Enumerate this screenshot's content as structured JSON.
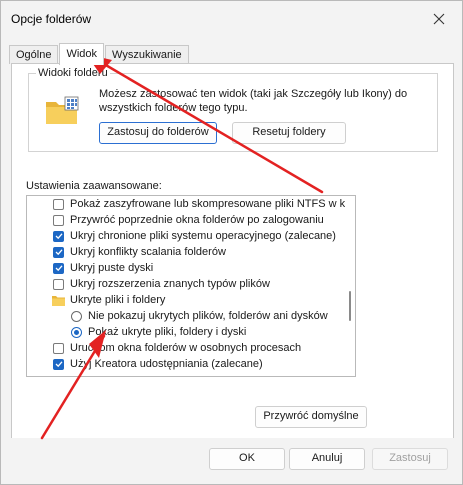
{
  "window": {
    "title": "Opcje folderów"
  },
  "tabs": [
    {
      "label": "Ogólne",
      "active": false
    },
    {
      "label": "Widok",
      "active": true
    },
    {
      "label": "Wyszukiwanie",
      "active": false
    }
  ],
  "folder_views": {
    "legend": "Widoki folderu",
    "description": "Możesz zastosować ten widok (taki jak Szczegóły lub Ikony) do wszystkich folderów tego typu.",
    "apply_button": "Zastosuj do folderów",
    "reset_button": "Resetuj foldery"
  },
  "advanced": {
    "label": "Ustawienia zaawansowane:",
    "items": [
      {
        "type": "checkbox",
        "checked": false,
        "label": "Pokaż zaszyfrowane lub skompresowane pliki NTFS w ko",
        "indent": 0
      },
      {
        "type": "checkbox",
        "checked": false,
        "label": "Przywróć poprzednie okna folderów po zalogowaniu",
        "indent": 0
      },
      {
        "type": "checkbox",
        "checked": true,
        "label": "Ukryj chronione pliki systemu operacyjnego (zalecane)",
        "indent": 0
      },
      {
        "type": "checkbox",
        "checked": true,
        "label": "Ukryj konflikty scalania folderów",
        "indent": 0
      },
      {
        "type": "checkbox",
        "checked": true,
        "label": "Ukryj puste dyski",
        "indent": 0
      },
      {
        "type": "checkbox",
        "checked": false,
        "label": "Ukryj rozszerzenia znanych typów plików",
        "indent": 0
      },
      {
        "type": "folder",
        "label": "Ukryte pliki i foldery",
        "indent": 0
      },
      {
        "type": "radio",
        "checked": false,
        "label": "Nie pokazuj ukrytych plików, folderów ani dysków",
        "indent": 1
      },
      {
        "type": "radio",
        "checked": true,
        "label": "Pokaż ukryte pliki, foldery i dyski",
        "indent": 1
      },
      {
        "type": "checkbox",
        "checked": false,
        "label": "Uruchom okna folderów w osobnych procesach",
        "indent": 0
      },
      {
        "type": "checkbox",
        "checked": true,
        "label": "Użyj Kreatora udostępniania (zalecane)",
        "indent": 0
      }
    ]
  },
  "restore_defaults_button": "Przywróć domyślne",
  "footer": {
    "ok": "OK",
    "cancel": "Anuluj",
    "apply": "Zastosuj"
  },
  "colors": {
    "accent": "#1c67c4",
    "annotation": "#e32222"
  }
}
